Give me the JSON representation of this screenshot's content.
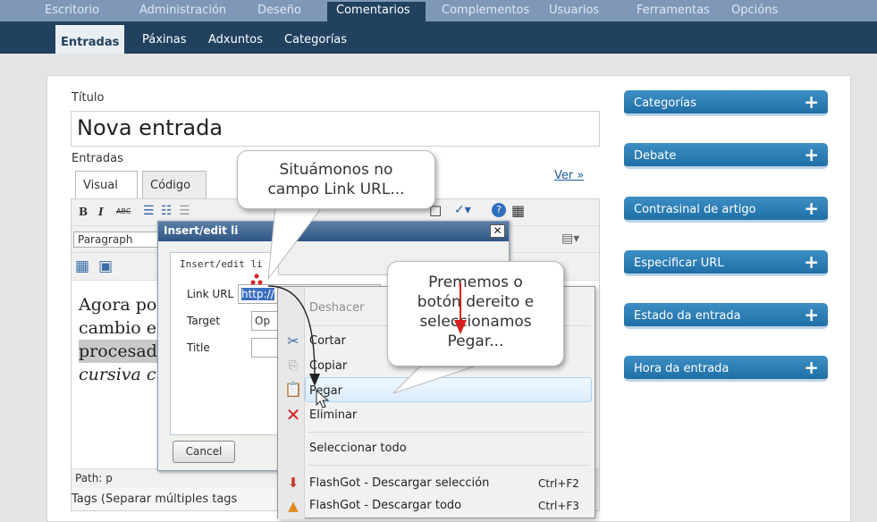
{
  "topnav": {
    "tabs": [
      "Escritorio",
      "Administración",
      "Deseño",
      "Comentarios",
      "Complementos",
      "Usuarios",
      "Ferramentas",
      "Opcións"
    ],
    "active_index": 3
  },
  "subnav": {
    "items": [
      "Entradas",
      "Páxinas",
      "Adxuntos",
      "Categorías"
    ],
    "active_index": 0
  },
  "editor": {
    "title_label": "Título",
    "title_value": "Nova entrada",
    "entries_label": "Entradas",
    "tab_visual": "Visual",
    "tab_code": "Código",
    "ver_link": "Ver »",
    "format_select": "Paragraph",
    "content_lines": [
      "Agora po",
      "cambio e",
      "procesad",
      "cursiva c"
    ],
    "path_label": "Path: p",
    "tags_label": "Tags (Separar múltiples tags"
  },
  "dialog": {
    "title": "Insert/edit li",
    "tab": "Insert/edit li",
    "link_url_label": "Link URL",
    "link_url_value": "http://",
    "target_label": "Target",
    "target_value": "Op",
    "title_label": "Title",
    "cancel": "Cancel",
    "close_glyph": "✕"
  },
  "context_menu": {
    "items": [
      {
        "label": "Deshacer",
        "enabled": false,
        "icon": "",
        "shortcut": ""
      },
      {
        "label": "Cortar",
        "enabled": true,
        "icon": "scissors-icon",
        "shortcut": ""
      },
      {
        "label": "Copiar",
        "enabled": false,
        "icon": "copy-icon",
        "shortcut": ""
      },
      {
        "label": "Pegar",
        "enabled": true,
        "icon": "paste-icon",
        "shortcut": ""
      },
      {
        "label": "Eliminar",
        "enabled": true,
        "icon": "delete-icon",
        "shortcut": ""
      },
      {
        "label": "Seleccionar todo",
        "enabled": true,
        "icon": "",
        "shortcut": ""
      },
      {
        "label": "FlashGot - Descargar selección",
        "enabled": true,
        "icon": "flashgot-icon",
        "shortcut": "Ctrl+F2"
      },
      {
        "label": "FlashGot - Descargar todo",
        "enabled": true,
        "icon": "flashgot-all-icon",
        "shortcut": "Ctrl+F3"
      }
    ],
    "highlighted": "Pegar"
  },
  "sidebar": {
    "boxes": [
      "Categorías",
      "Debate",
      "Contrasinal de artigo",
      "Especificar URL",
      "Estado da entrada",
      "Hora da entrada"
    ],
    "plus": "+"
  },
  "callouts": {
    "first": [
      "Situámonos no",
      "campo Link URL..."
    ],
    "second": [
      "Prememos o",
      "botón dereito e",
      "seleccionamos",
      "Pegar..."
    ]
  },
  "colors": {
    "header_dark": "#21415e",
    "sidebar_blue": "#2a7db4",
    "arrow_red": "#d62020"
  }
}
